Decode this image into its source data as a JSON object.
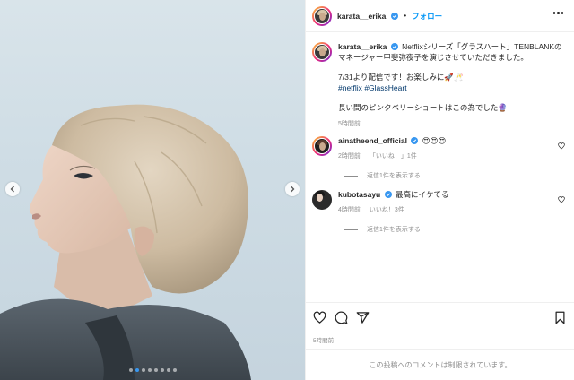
{
  "post": {
    "username": "karata__erika",
    "separator": "•",
    "follow_label": "フォロー",
    "caption": {
      "username": "karata__erika",
      "line1": "Netflixシリーズ「グラスハート」TENBLANKのマネージャー甲斐弥夜子を演じさせていただきました。",
      "line2": "7/31より配信です！お楽しみに🚀🥂",
      "tags": [
        "#netflix",
        "#GlassHeart"
      ],
      "line3": "長い間のピンクベリーショートはこの為でした🔮",
      "time": "5時間前"
    },
    "comments": [
      {
        "username": "ainatheend_official",
        "text": "😍😍😍",
        "time": "2時間前",
        "likes": "「いいね！」1件",
        "replies": "返信1件を表示する"
      },
      {
        "username": "kubotasayu",
        "text": "最高にイケてる",
        "time": "4時間前",
        "likes": "いいね！3件",
        "replies": "返信1件を表示する"
      }
    ],
    "post_time": "5時間前",
    "comments_restricted": "この投稿へのコメントは制限されています。"
  },
  "carousel": {
    "total": 8,
    "active_index": 1
  },
  "icons": {
    "verified": "verified-badge-icon",
    "like": "heart-icon",
    "comment": "comment-icon",
    "share": "share-icon",
    "save": "bookmark-icon",
    "more": "more-options-icon",
    "prev": "chevron-left-icon",
    "next": "chevron-right-icon"
  },
  "colors": {
    "link": "#0095f6",
    "hashtag": "#00376b",
    "muted": "#8e8e8e",
    "active_dot": "#3897f0"
  }
}
